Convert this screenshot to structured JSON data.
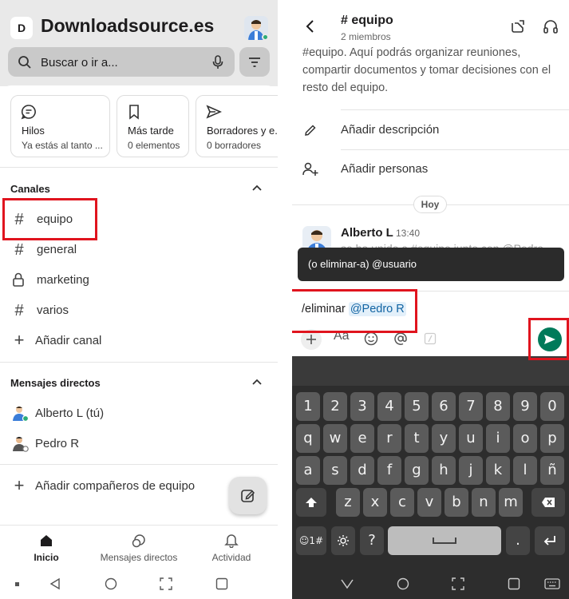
{
  "left": {
    "workspace": {
      "initial": "D",
      "name": "Downloadsource.es"
    },
    "search": {
      "placeholder": "Buscar o ir a..."
    },
    "cards": [
      {
        "label": "Hilos",
        "sub": "Ya estás al tanto ..."
      },
      {
        "label": "Más tarde",
        "sub": "0 elementos"
      },
      {
        "label": "Borradores y e...",
        "sub": "0 borradores"
      }
    ],
    "channels": {
      "title": "Canales",
      "items": [
        {
          "label": "equipo",
          "icon": "hash-icon"
        },
        {
          "label": "general",
          "icon": "hash-icon"
        },
        {
          "label": "marketing",
          "icon": "lock-icon"
        },
        {
          "label": "varios",
          "icon": "hash-icon"
        }
      ],
      "add_label": "Añadir canal"
    },
    "dms": {
      "title": "Mensajes directos",
      "items": [
        {
          "label": "Alberto L (tú)"
        },
        {
          "label": "Pedro R"
        }
      ],
      "add_label": "Añadir compañeros de equipo"
    },
    "tabs": [
      {
        "label": "Inicio"
      },
      {
        "label": "Mensajes directos"
      },
      {
        "label": "Actividad"
      }
    ]
  },
  "right": {
    "header": {
      "title": "# equipo",
      "subtitle": "2 miembros"
    },
    "intro": "#equipo. Aquí podrás organizar reuniones, compartir documentos y tomar decisiones con el resto del equipo.",
    "actions": [
      {
        "label": "Añadir descripción"
      },
      {
        "label": "Añadir personas"
      }
    ],
    "day_divider": "Hoy",
    "message": {
      "author": "Alberto L",
      "time": "13:40",
      "faded_text": "se ha unido a #equipo junto con @Pedro"
    },
    "tooltip": "(o eliminar-a) @usuario",
    "composer": {
      "command": "/eliminar ",
      "mention": "@Pedro R",
      "format_label": "Aa"
    },
    "keyboard": {
      "row_numbers": [
        "1",
        "2",
        "3",
        "4",
        "5",
        "6",
        "7",
        "8",
        "9",
        "0"
      ],
      "row1": [
        "q",
        "w",
        "e",
        "r",
        "t",
        "y",
        "u",
        "i",
        "o",
        "p"
      ],
      "row2": [
        "a",
        "s",
        "d",
        "f",
        "g",
        "h",
        "j",
        "k",
        "l",
        "ñ"
      ],
      "row3": [
        "z",
        "x",
        "c",
        "v",
        "b",
        "n",
        "m"
      ],
      "symbols_label": "☺1#",
      "question": "?",
      "period": "."
    }
  },
  "colors": {
    "accent_green": "#007a5a",
    "highlight_red": "#e0141e",
    "mention_blue": "#1264a3"
  }
}
